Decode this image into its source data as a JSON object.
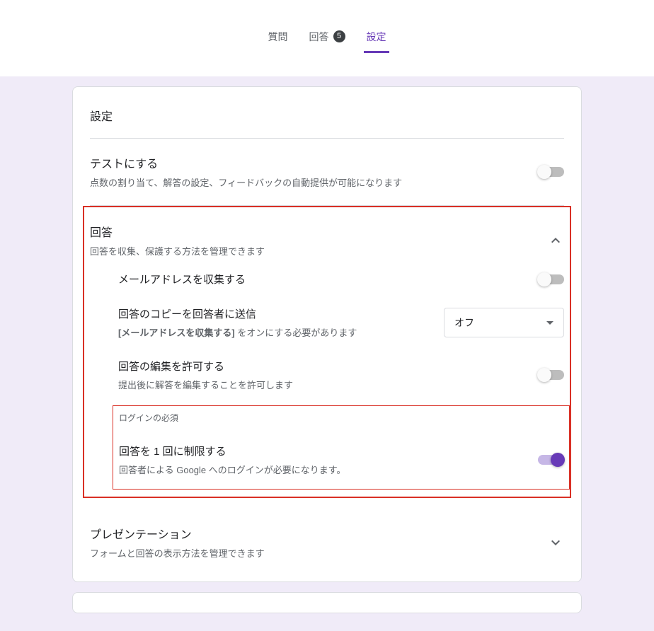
{
  "tabs": {
    "questions": "質問",
    "responses": "回答",
    "responsesCount": "5",
    "settings": "設定"
  },
  "card": {
    "title": "設定",
    "quiz": {
      "title": "テストにする",
      "desc": "点数の割り当て、解答の設定、フィードバックの自動提供が可能になります"
    },
    "responses": {
      "title": "回答",
      "desc": "回答を収集、保護する方法を管理できます",
      "collectEmail": "メールアドレスを収集する",
      "sendCopy": {
        "title": "回答のコピーを回答者に送信",
        "descBold": "[メールアドレスを収集する]",
        "descRest": " をオンにする必要があります"
      },
      "selectValue": "オフ",
      "allowEdit": {
        "title": "回答の編集を許可する",
        "desc": "提出後に解答を編集することを許可します"
      },
      "loginRequired": "ログインの必須",
      "limitOne": {
        "title": "回答を 1 回に制限する",
        "desc": "回答者による Google へのログインが必要になります。"
      }
    },
    "presentation": {
      "title": "プレゼンテーション",
      "desc": "フォームと回答の表示方法を管理できます"
    }
  }
}
